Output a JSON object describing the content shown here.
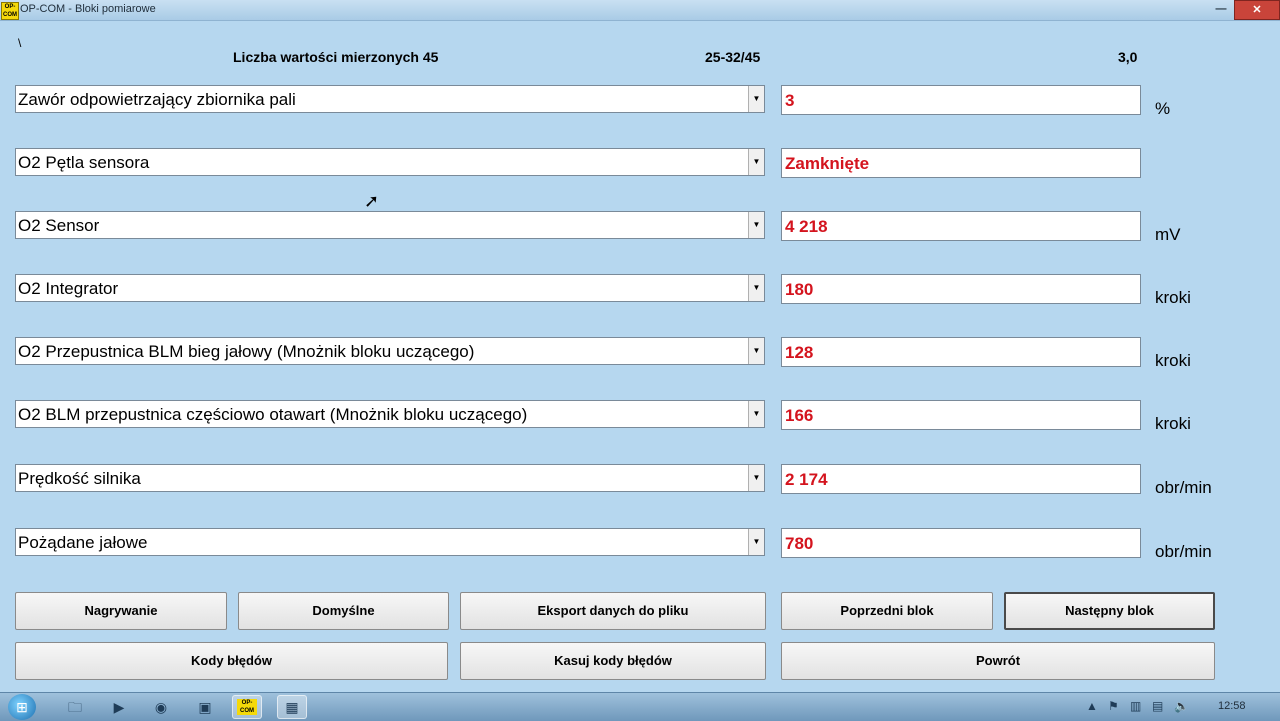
{
  "window": {
    "title": "OP-COM - Bloki pomiarowe",
    "app_icon_text": "OP-COM",
    "close_icon": "close-icon",
    "minimize_icon": "minimize-icon"
  },
  "header": {
    "marker": "\\",
    "count_label": "Liczba wartości mierzonych 45",
    "range": "25-32/45",
    "version": "3,0"
  },
  "rows": [
    {
      "name": "Zawór odpowietrzający zbiornika pali",
      "value": "3",
      "unit": "%"
    },
    {
      "name": "O2 Pętla sensora",
      "value": "Zamknięte",
      "unit": ""
    },
    {
      "name": "O2 Sensor",
      "value": "4 218",
      "unit": "mV"
    },
    {
      "name": "O2 Integrator",
      "value": "180",
      "unit": "kroki"
    },
    {
      "name": "O2 Przepustnica BLM bieg jałowy (Mnożnik bloku uczącego)",
      "value": "128",
      "unit": "kroki"
    },
    {
      "name": "O2 BLM przepustnica częściowo otawart (Mnożnik bloku uczącego)",
      "value": "166",
      "unit": "kroki"
    },
    {
      "name": "Prędkość silnika",
      "value": "2 174",
      "unit": "obr/min"
    },
    {
      "name": "Pożądane jałowe",
      "value": "780",
      "unit": "obr/min"
    }
  ],
  "buttons": {
    "record": "Nagrywanie",
    "defaults": "Domyślne",
    "export": "Eksport danych do pliku",
    "prev_block": "Poprzedni blok",
    "next_block": "Następny blok",
    "error_codes": "Kody błędów",
    "clear_codes": "Kasuj kody błędów",
    "back": "Powrót"
  },
  "taskbar": {
    "clock": "12:58",
    "opcom_label": "OP-COM"
  },
  "colors": {
    "background": "#b6d7ef",
    "value_text": "#d4141e"
  }
}
